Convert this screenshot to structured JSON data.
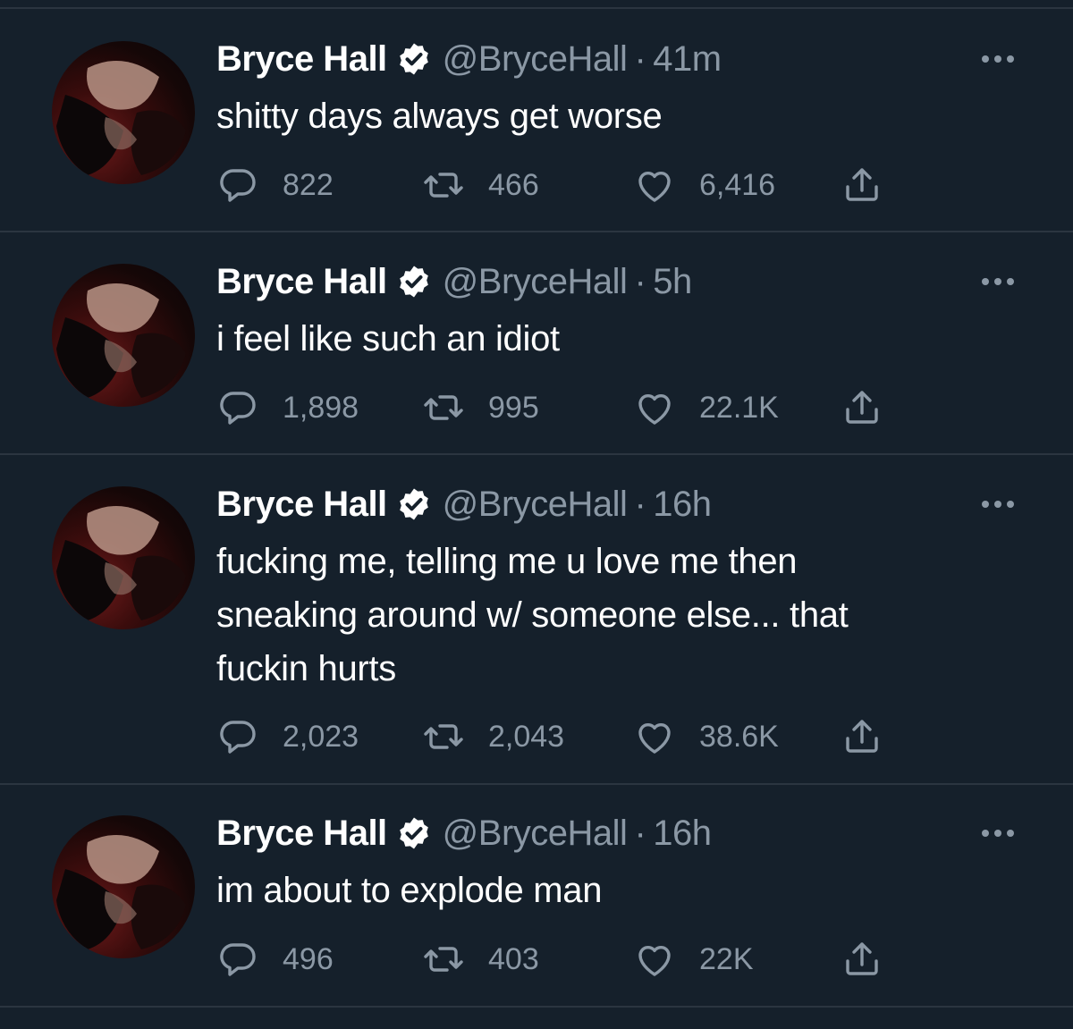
{
  "colors": {
    "background": "#15202b",
    "text_primary": "#ffffff",
    "text_secondary": "#8b98a5",
    "divider": "#2b3540"
  },
  "icons": {
    "reply": "reply-icon",
    "retweet": "retweet-icon",
    "like": "heart-icon",
    "share": "share-icon",
    "verified": "verified-badge-icon",
    "more": "more-icon"
  },
  "tweets": [
    {
      "name": "Bryce Hall",
      "handle": "@BryceHall",
      "separator": "·",
      "time": "41m",
      "lines": [
        "shitty days always get worse"
      ],
      "replies": "822",
      "retweets": "466",
      "likes": "6,416"
    },
    {
      "name": "Bryce Hall",
      "handle": "@BryceHall",
      "separator": "·",
      "time": "5h",
      "lines": [
        "i feel like such an idiot"
      ],
      "replies": "1,898",
      "retweets": "995",
      "likes": "22.1K"
    },
    {
      "name": "Bryce Hall",
      "handle": "@BryceHall",
      "separator": "·",
      "time": "16h",
      "lines": [
        "fucking me, telling me u love me then",
        "sneaking around w/ someone else... that",
        "fuckin hurts"
      ],
      "replies": "2,023",
      "retweets": "2,043",
      "likes": "38.6K"
    },
    {
      "name": "Bryce Hall",
      "handle": "@BryceHall",
      "separator": "·",
      "time": "16h",
      "lines": [
        "im about to explode man"
      ],
      "replies": "496",
      "retweets": "403",
      "likes": "22K"
    }
  ]
}
